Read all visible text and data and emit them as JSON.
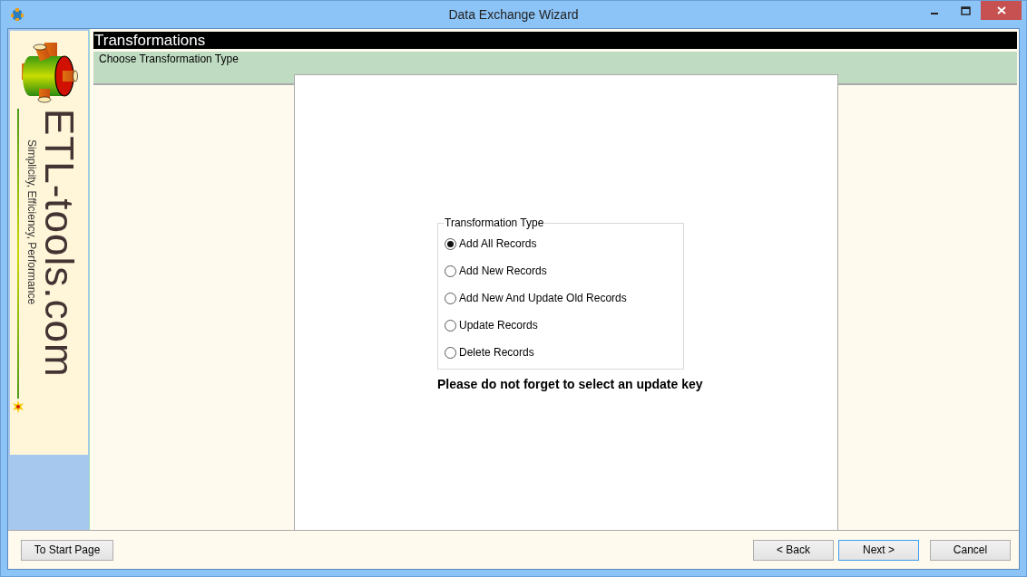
{
  "window": {
    "title": "Data Exchange Wizard"
  },
  "sidebar": {
    "logo_text": "ETL-tools.com",
    "tagline": "Simplicity, Efficiency, Performance"
  },
  "header": {
    "title": "Transformations",
    "subtitle": "Choose Transformation Type"
  },
  "group": {
    "title": "Transformation Type",
    "options": [
      {
        "label": "Add All Records",
        "selected": true
      },
      {
        "label": "Add New Records",
        "selected": false
      },
      {
        "label": "Add New And Update Old Records",
        "selected": false
      },
      {
        "label": "Update Records",
        "selected": false
      },
      {
        "label": "Delete Records",
        "selected": false
      }
    ]
  },
  "note": "Please do not forget to select an update key",
  "left_buttons": [
    {
      "label": "To Start Page",
      "default": false
    }
  ],
  "right_buttons": [
    {
      "label": "< Back",
      "default": false
    },
    {
      "label": "Next >",
      "default": true
    },
    {
      "label": "Cancel",
      "default": false
    }
  ]
}
